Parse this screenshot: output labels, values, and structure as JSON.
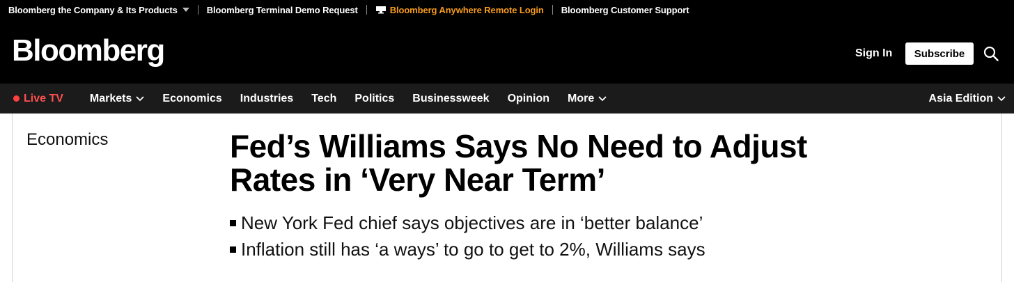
{
  "topbar": {
    "company_products": "Bloomberg the Company & Its Products",
    "terminal_demo": "Bloomberg Terminal Demo Request",
    "anywhere_login": "Bloomberg Anywhere Remote Login",
    "customer_support": "Bloomberg Customer Support"
  },
  "header": {
    "logo": "Bloomberg",
    "sign_in": "Sign In",
    "subscribe": "Subscribe"
  },
  "nav": {
    "live_tv": "Live TV",
    "items": [
      "Markets",
      "Economics",
      "Industries",
      "Tech",
      "Politics",
      "Businessweek",
      "Opinion",
      "More"
    ],
    "edition": "Asia Edition"
  },
  "article": {
    "section": "Economics",
    "headline_line1": "Fed’s Williams Says No Need to Adjust",
    "headline_line2": "Rates in ‘Very Near Term’",
    "bullets": [
      "New York Fed chief says objectives are in ‘better balance’",
      "Inflation still has ‘a ways’ to go to get to 2%, Williams says"
    ]
  },
  "colors": {
    "anywhere_link": "#f89c1c",
    "live_tv": "#ff5050",
    "nav_bg": "#1b1b1b"
  }
}
